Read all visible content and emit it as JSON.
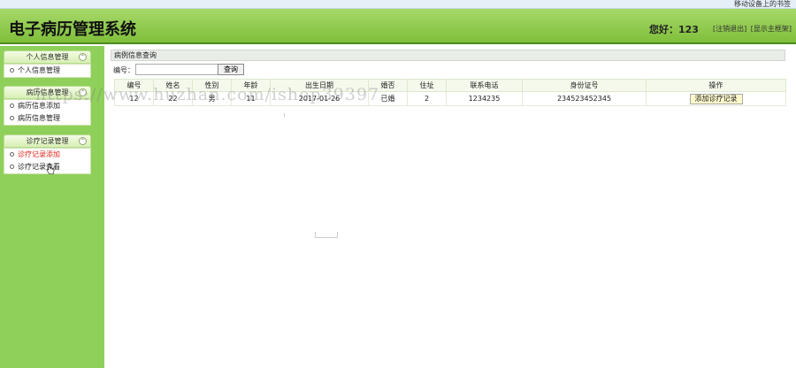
{
  "browser": {
    "bookmark_text": "移动设备上的书签"
  },
  "header": {
    "title": "电子病历管理系统",
    "greeting": "您好：123",
    "links": [
      "[注销退出]",
      "[显示主框架]"
    ]
  },
  "sidebar": {
    "sections": [
      {
        "title": "个人信息管理",
        "items": [
          {
            "label": "个人信息管理",
            "active": false
          }
        ]
      },
      {
        "title": "病历信息管理",
        "items": [
          {
            "label": "病历信息添加",
            "active": false
          },
          {
            "label": "病历信息管理",
            "active": false
          }
        ]
      },
      {
        "title": "诊疗记录管理",
        "items": [
          {
            "label": "诊疗记录添加",
            "active": true
          },
          {
            "label": "诊疗记录查看",
            "active": false
          }
        ]
      }
    ]
  },
  "main": {
    "panel_title": "病例信息查询",
    "search": {
      "label": "编号：",
      "value": "",
      "placeholder": "",
      "button": "查询"
    },
    "table": {
      "columns": [
        "编号",
        "姓名",
        "性别",
        "年龄",
        "出生日期",
        "婚否",
        "住址",
        "联系电话",
        "身份证号",
        "操作"
      ],
      "rows": [
        [
          "12",
          "22",
          "男",
          "11",
          "2017-01-26",
          "已婚",
          "2",
          "1234235",
          "234523452345",
          "添加诊疗记录"
        ]
      ]
    }
  },
  "watermark": "https://www.huzhan.com/ishop39397",
  "colors": {
    "header_green": "#7fbf3a",
    "sidebar_green": "#8fd05a",
    "active_item": "#e1251b"
  }
}
